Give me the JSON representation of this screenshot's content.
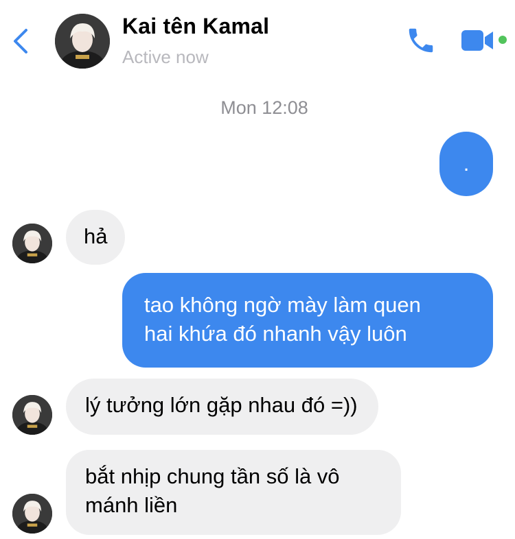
{
  "header": {
    "contact_name": "Kai tên Kamal",
    "status": "Active now"
  },
  "thread": {
    "timestamp": "Mon 12:08",
    "messages": [
      {
        "from": "me",
        "text": "."
      },
      {
        "from": "them",
        "text": "hả"
      },
      {
        "from": "me",
        "lines": [
          "tao không ngờ mày làm quen",
          "hai khứa đó nhanh vậy luôn"
        ]
      },
      {
        "from": "them",
        "text": "lý tưởng lớn gặp nhau đó =))"
      },
      {
        "from": "them",
        "lines": [
          "bắt nhịp chung tần số là vô",
          "mánh liền"
        ]
      }
    ]
  },
  "colors": {
    "accent": "#3d88ee",
    "incoming_bubble": "#efeff0",
    "online": "#52c45c"
  },
  "icons": [
    "back-chevron-icon",
    "phone-icon",
    "video-camera-icon"
  ]
}
